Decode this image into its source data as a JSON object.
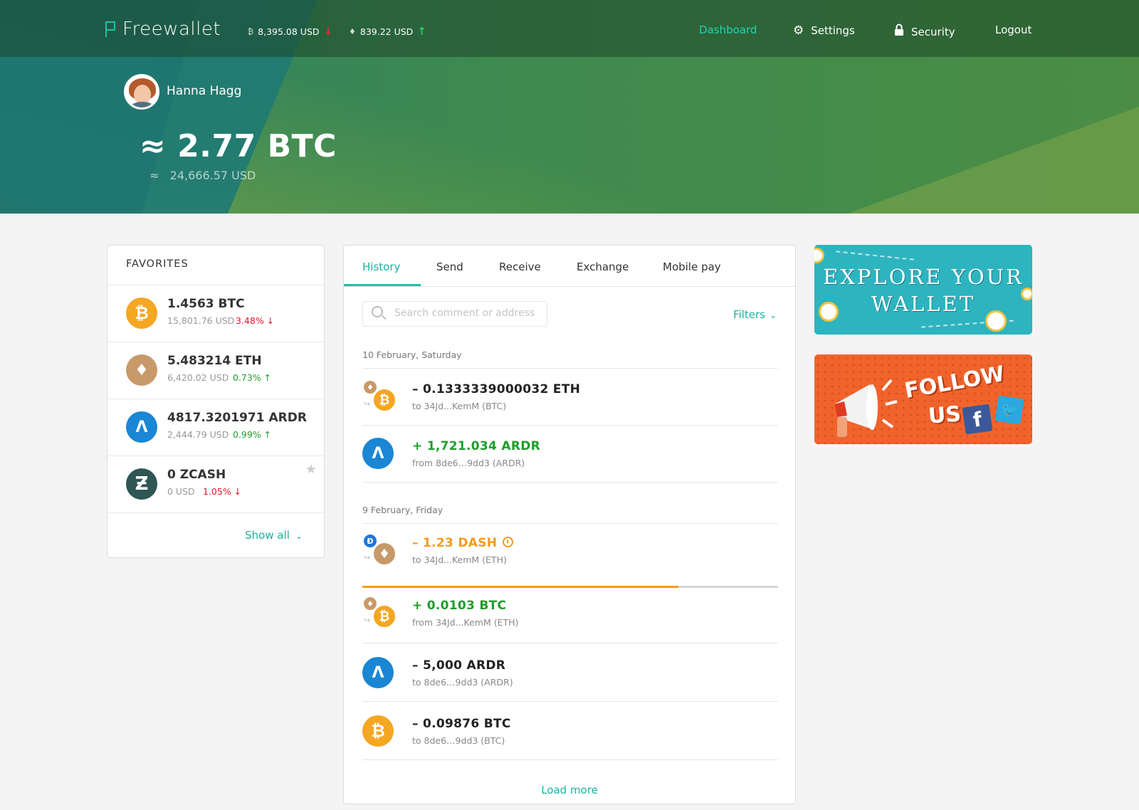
{
  "app": {
    "name": "Freewallet"
  },
  "tickers": [
    {
      "icon": "bitcoin-icon",
      "glyph": "₿",
      "value": "8,395.08 USD",
      "trend_glyph": "↓"
    },
    {
      "icon": "ethereum-icon",
      "glyph": "♦",
      "value": "839.22 USD",
      "trend_glyph": "↑"
    }
  ],
  "nav": {
    "dashboard": "Dashboard",
    "settings": "Settings",
    "security": "Security",
    "logout": "Logout"
  },
  "user": {
    "name": "Hanna Hagg",
    "balance_btc": "≈ 2.77 BTC",
    "balance_usd": "≈   24,666.57 USD"
  },
  "favorites": {
    "title": "FAVORITES",
    "items": [
      {
        "icon": "bitcoin-icon",
        "glyph": "₿",
        "amount": "1.4563 BTC",
        "usd": "15,801.76 USD",
        "change": "3.48% ↓"
      },
      {
        "icon": "ethereum-icon",
        "glyph": "♦",
        "amount": "5.483214 ETH",
        "usd": "6,420.02 USD",
        "change": "0.73% ↑"
      },
      {
        "icon": "ardor-icon",
        "glyph": "Λ",
        "amount": "4817.3201971 ARDR",
        "usd": "2,444.79 USD",
        "change": "0.99% ↑"
      },
      {
        "icon": "zcash-icon",
        "glyph": "Ƶ",
        "amount": "0 ZCASH",
        "usd": "0 USD",
        "change": "1.05% ↓"
      }
    ],
    "show_all": "Show all",
    "chevron": "⌄"
  },
  "history": {
    "tabs": [
      "History",
      "Send",
      "Receive",
      "Exchange",
      "Mobile pay"
    ],
    "search_placeholder": "Search comment or address",
    "filters": "Filters",
    "chevron": "⌄",
    "groups": [
      {
        "date": "10 February, Saturday"
      },
      {
        "date": "9 February, Friday"
      }
    ],
    "transactions": [
      {
        "amount": "– 0.1333339000032 ETH",
        "detail": "to 34Jd...KemM (BTC)",
        "from_glyph": "♦",
        "to_glyph": "₿"
      },
      {
        "amount": "+ 1,721.034 ARDR",
        "detail": "from 8de6…9dd3 (ARDR)",
        "glyph": "Λ"
      },
      {
        "amount": "– 1.23 DASH",
        "detail": "to 34Jd...KemM (ETH)",
        "from_glyph": "Đ",
        "to_glyph": "♦",
        "progress": 0.76
      },
      {
        "amount": "+ 0.0103 BTC",
        "detail": "from 34Jd...KemM (ETH)",
        "from_glyph": "♦",
        "to_glyph": "₿"
      },
      {
        "amount": "– 5,000 ARDR",
        "detail": "to 8de6…9dd3 (ARDR)",
        "glyph": "Λ"
      },
      {
        "amount": "– 0.09876 BTC",
        "detail": "to 8de6…9dd3 (BTC)",
        "glyph": "₿"
      }
    ],
    "load_more": "Load more"
  },
  "banners": {
    "explore": {
      "line1": "EXPLORE YOUR",
      "line2": "WALLET"
    },
    "follow": {
      "line1": "FOLLOW",
      "line2": "US",
      "fb": "f",
      "tw": "🐦"
    }
  },
  "colors": {
    "accent": "#19b3a0",
    "positive": "#1f9d2a",
    "negative": "#e0162b",
    "pending": "#f39a1e"
  }
}
